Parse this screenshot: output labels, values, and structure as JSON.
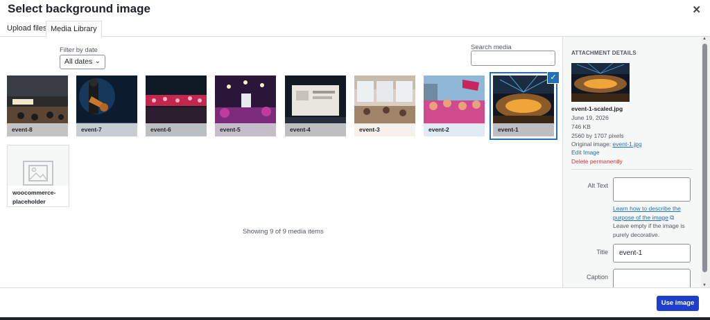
{
  "modal": {
    "title": "Select background image",
    "close_icon": "close-icon"
  },
  "tabs": [
    {
      "label": "Upload files"
    },
    {
      "label": "Media Library",
      "active": true
    }
  ],
  "filter": {
    "label": "Filter by date",
    "value": "All dates"
  },
  "search": {
    "label": "Search media",
    "value": ""
  },
  "media": [
    {
      "name": "event-8"
    },
    {
      "name": "event-7"
    },
    {
      "name": "event-6"
    },
    {
      "name": "event-5"
    },
    {
      "name": "event-4"
    },
    {
      "name": "event-3"
    },
    {
      "name": "event-2"
    },
    {
      "name": "event-1",
      "selected": true
    },
    {
      "name": "woocommerce-placeholder"
    }
  ],
  "showing": "Showing 9 of 9 media items",
  "details": {
    "heading": "ATTACHMENT DETAILS",
    "filename": "event-1-scaled.jpg",
    "date": "June 19, 2026",
    "size": "746 KB",
    "dimensions": "2560 by 1707 pixels",
    "original_prefix": "Original image: ",
    "original_link": "event-1.jpg",
    "edit": "Edit Image",
    "delete": "Delete permanently",
    "alt_label": "Alt Text",
    "alt_value": "",
    "alt_help_link": "Learn how to describe the purpose of the image",
    "alt_help_text": "Leave empty if the image is purely decorative.",
    "title_label": "Title",
    "title_value": "event-1",
    "caption_label": "Caption",
    "caption_value": ""
  },
  "footer": {
    "use_label": "Use image"
  },
  "colors": {
    "accent": "#2271b1",
    "primary_button": "#1e3fce",
    "danger": "#d63638"
  }
}
